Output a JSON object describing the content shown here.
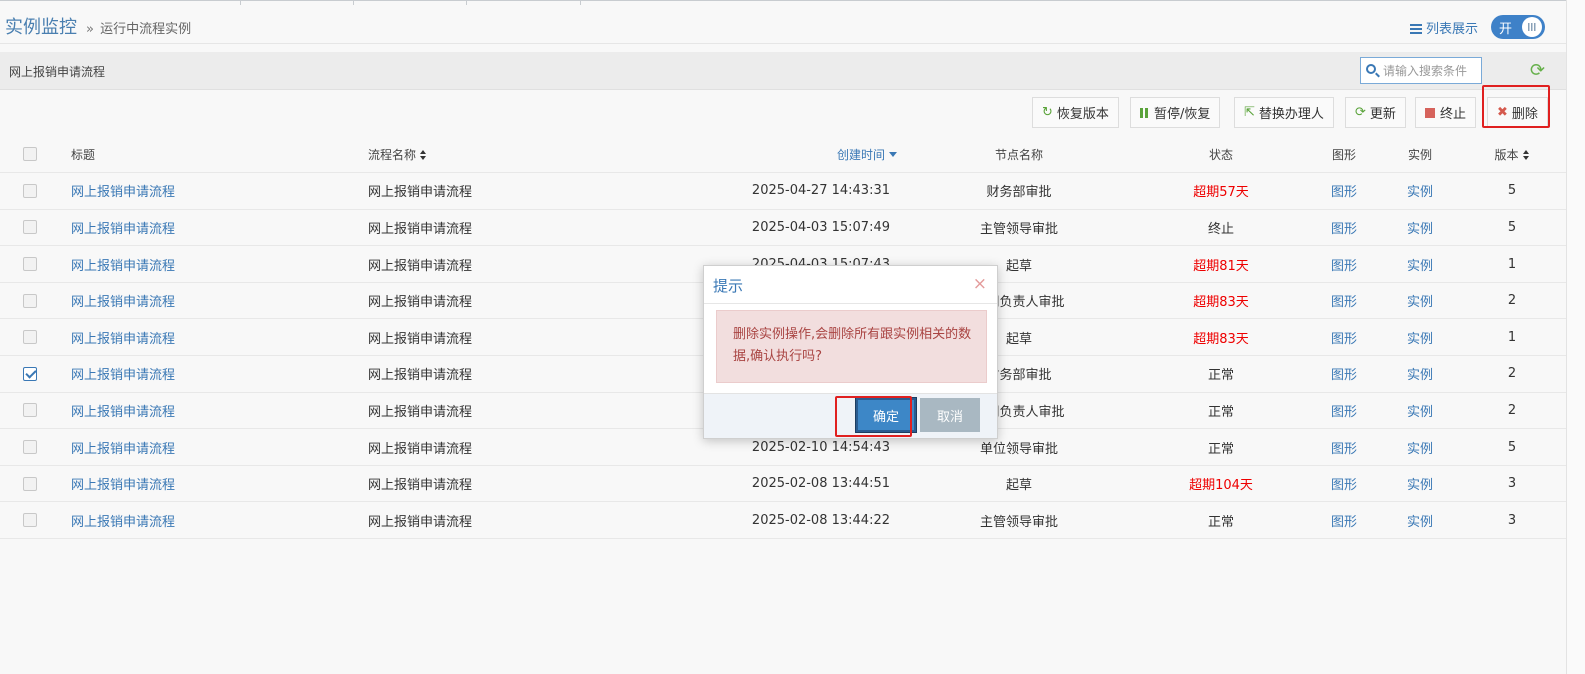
{
  "header": {
    "title": "实例监控",
    "breadcrumb_sep": "»",
    "breadcrumb": "运行中流程实例",
    "list_view_label": "列表展示",
    "toggle_label": "开"
  },
  "grid": {
    "title": "网上报销申请流程",
    "search_placeholder": "请输入搜索条件"
  },
  "toolbar": {
    "restore_version": "恢复版本",
    "pause_resume": "暂停/恢复",
    "replace_handler": "替换办理人",
    "update": "更新",
    "terminate": "终止",
    "delete": "删除"
  },
  "table": {
    "columns": [
      "标题",
      "流程名称",
      "创建时间",
      "节点名称",
      "状态",
      "图形",
      "实例",
      "版本"
    ],
    "rows": [
      {
        "title": "网上报销申请流程",
        "process": "网上报销申请流程",
        "created": "2025-04-27 14:43:31",
        "node": "财务部审批",
        "status": "超期57天",
        "graphic": "图形",
        "instance": "实例",
        "version": "5",
        "checked": false
      },
      {
        "title": "网上报销申请流程",
        "process": "网上报销申请流程",
        "created": "2025-04-03 15:07:49",
        "node": "主管领导审批",
        "status": "终止",
        "graphic": "图形",
        "instance": "实例",
        "version": "5",
        "checked": false
      },
      {
        "title": "网上报销申请流程",
        "process": "网上报销申请流程",
        "created": "2025-04-03 15:07:43",
        "node": "起草",
        "status": "超期81天",
        "graphic": "图形",
        "instance": "实例",
        "version": "1",
        "checked": false
      },
      {
        "title": "网上报销申请流程",
        "process": "网上报销申请流程",
        "created": "",
        "node": "部门负责人审批",
        "status": "超期83天",
        "graphic": "图形",
        "instance": "实例",
        "version": "2",
        "checked": false
      },
      {
        "title": "网上报销申请流程",
        "process": "网上报销申请流程",
        "created": "",
        "node": "起草",
        "status": "超期83天",
        "graphic": "图形",
        "instance": "实例",
        "version": "1",
        "checked": false
      },
      {
        "title": "网上报销申请流程",
        "process": "网上报销申请流程",
        "created": "",
        "node": "财务部审批",
        "status": "正常",
        "graphic": "图形",
        "instance": "实例",
        "version": "2",
        "checked": true
      },
      {
        "title": "网上报销申请流程",
        "process": "网上报销申请流程",
        "created": "",
        "node": "部门负责人审批",
        "status": "正常",
        "graphic": "图形",
        "instance": "实例",
        "version": "2",
        "checked": false
      },
      {
        "title": "网上报销申请流程",
        "process": "网上报销申请流程",
        "created": "2025-02-10 14:54:43",
        "node": "单位领导审批",
        "status": "正常",
        "graphic": "图形",
        "instance": "实例",
        "version": "5",
        "checked": false
      },
      {
        "title": "网上报销申请流程",
        "process": "网上报销申请流程",
        "created": "2025-02-08 13:44:51",
        "node": "起草",
        "status": "超期104天",
        "graphic": "图形",
        "instance": "实例",
        "version": "3",
        "checked": false
      },
      {
        "title": "网上报销申请流程",
        "process": "网上报销申请流程",
        "created": "2025-02-08 13:44:22",
        "node": "主管领导审批",
        "status": "正常",
        "graphic": "图形",
        "instance": "实例",
        "version": "3",
        "checked": false
      }
    ]
  },
  "dialog": {
    "title": "提示",
    "close": "×",
    "message": "删除实例操作,会删除所有跟实例相关的数据,确认执行吗?",
    "ok": "确定",
    "cancel": "取消"
  },
  "colors": {
    "link": "#3a78b5",
    "overdue": "#ee0000",
    "alert_bg": "#f2dede",
    "highlight": "#e02020"
  },
  "icons": {
    "list_view": "list-icon",
    "search": "search-icon",
    "refresh": "refresh-icon",
    "close": "close-icon"
  }
}
